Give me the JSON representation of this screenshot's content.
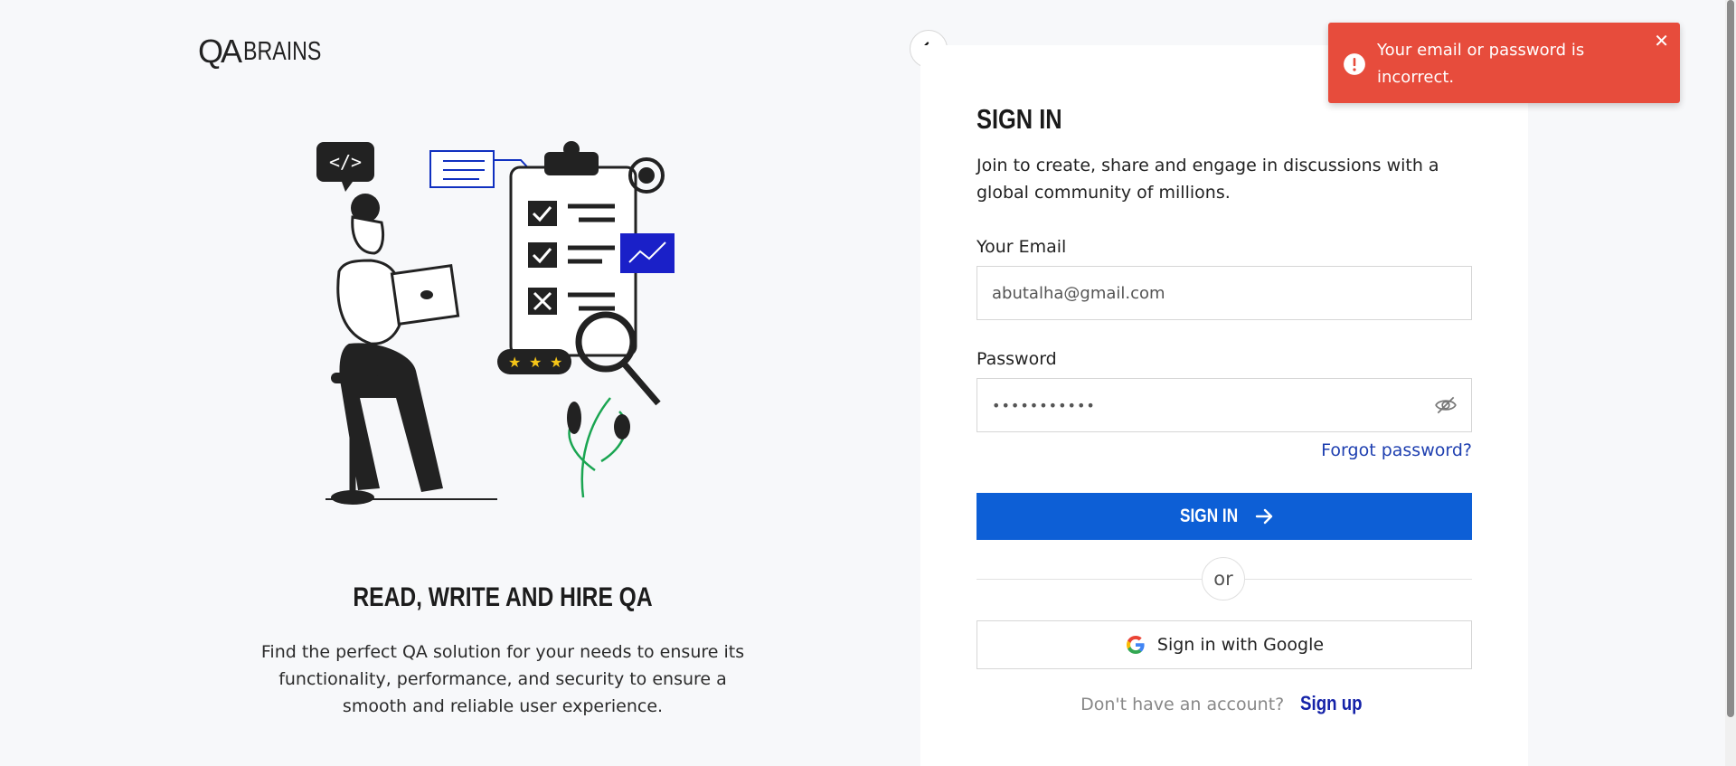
{
  "logo": {
    "qa": "QA",
    "brains": "BRAINS"
  },
  "left": {
    "tagline": "READ, WRITE AND HIRE QA",
    "description": "Find the perfect QA solution for your needs to ensure its functionality, performance, and security to ensure a smooth and reliable user experience."
  },
  "form": {
    "title": "SIGN IN",
    "description": "Join to create, share and engage in discussions with a global community of millions.",
    "email_label": "Your Email",
    "email_value": "abutalha@gmail.com",
    "password_label": "Password",
    "password_value": "•••••••••••",
    "forgot_password": "Forgot password?",
    "signin_button": "SIGN IN",
    "or": "or",
    "google_button": "Sign in with Google",
    "no_account": "Don't have an account?",
    "signup": "Sign up"
  },
  "toast": {
    "message": "Your email or password is incorrect.",
    "close": "✕"
  },
  "colors": {
    "primary": "#0d5fd6",
    "error": "#e74c3c",
    "link": "#1e3fb0"
  }
}
